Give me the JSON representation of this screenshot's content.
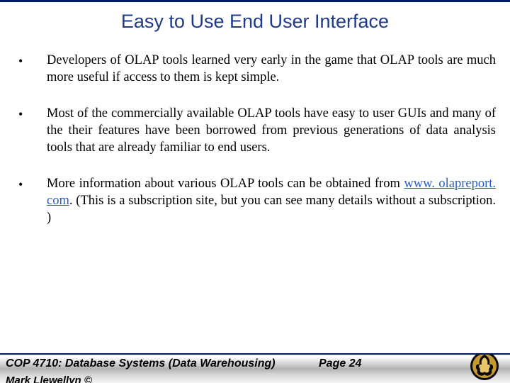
{
  "title": "Easy to Use End User Interface",
  "bullets": [
    {
      "text": "Developers of OLAP tools learned very early in the game that OLAP tools are much more useful if access to them is kept simple."
    },
    {
      "text": "Most of the commercially available OLAP tools have easy to user GUIs and many of the their features have been borrowed from previous generations of data analysis tools that are already familiar to end users."
    },
    {
      "pre": "More information about various OLAP tools can be obtained from ",
      "link": "www. olapreport. com",
      "post": ".  (This is a subscription site, but you can see many details without a subscription. )"
    }
  ],
  "footer": {
    "course": "COP 4710: Database Systems  (Data Warehousing)",
    "author": "Mark Llewellyn ©",
    "page": "Page 24"
  }
}
